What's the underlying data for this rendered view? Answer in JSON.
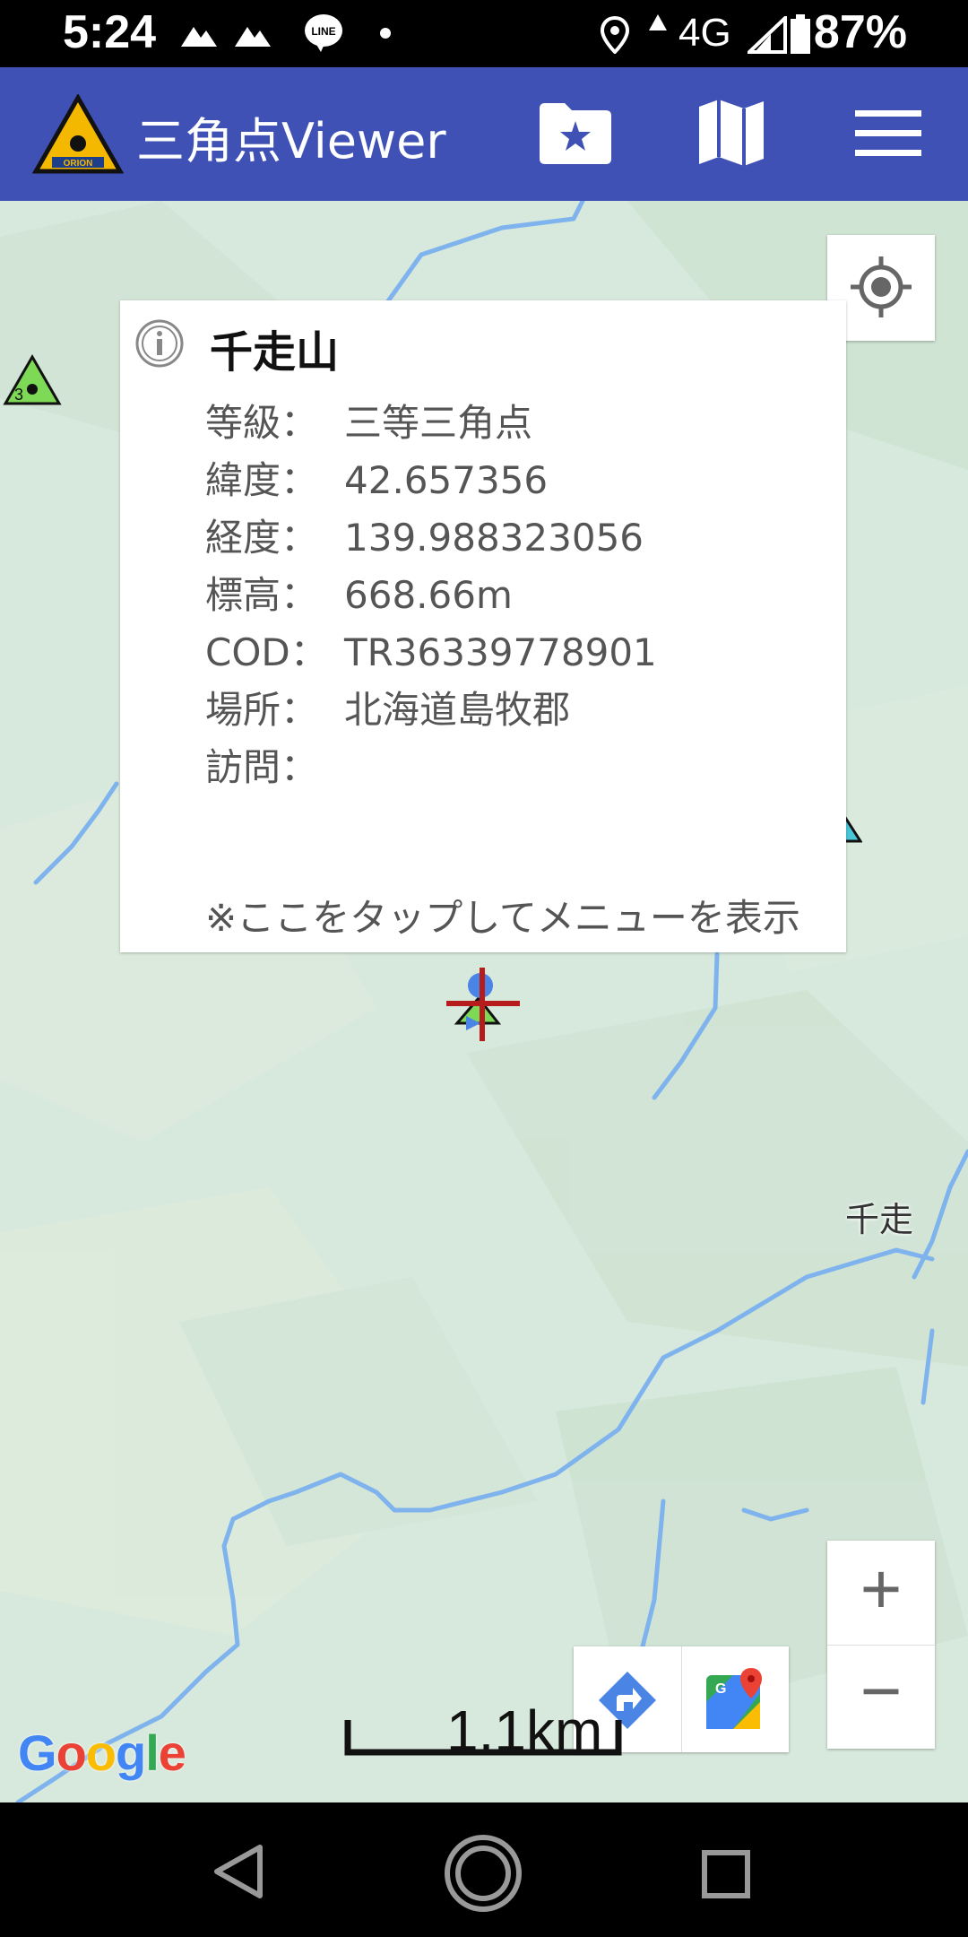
{
  "status_bar": {
    "time": "5:24",
    "network": "4G",
    "battery": "87%"
  },
  "app_bar": {
    "title": "三角点Viewer",
    "logo_text": "ORION"
  },
  "info_window": {
    "title": "千走山",
    "rows": [
      {
        "key": "等級：",
        "value": "三等三角点"
      },
      {
        "key": "緯度：",
        "value": "42.657356"
      },
      {
        "key": "経度：",
        "value": "139.988323056"
      },
      {
        "key": "標高：",
        "value": "668.66m"
      },
      {
        "key": "COD：",
        "value": "TR36339778901"
      },
      {
        "key": "場所：",
        "value": "北海道島牧郡"
      },
      {
        "key": "訪問：",
        "value": ""
      }
    ],
    "hint": "※ここをタップしてメニューを表示"
  },
  "map": {
    "place_label": "千走",
    "scale_label": "1.1km",
    "marker_label": "3",
    "attribution": "Google",
    "zoom_in": "+",
    "zoom_out": "−"
  },
  "colors": {
    "app_bar": "#3F51B5",
    "map_bg": "#d7e8dc",
    "water": "#7fb3ee",
    "triangle_green": "#7ed957",
    "crosshair": "#b71c1c"
  }
}
